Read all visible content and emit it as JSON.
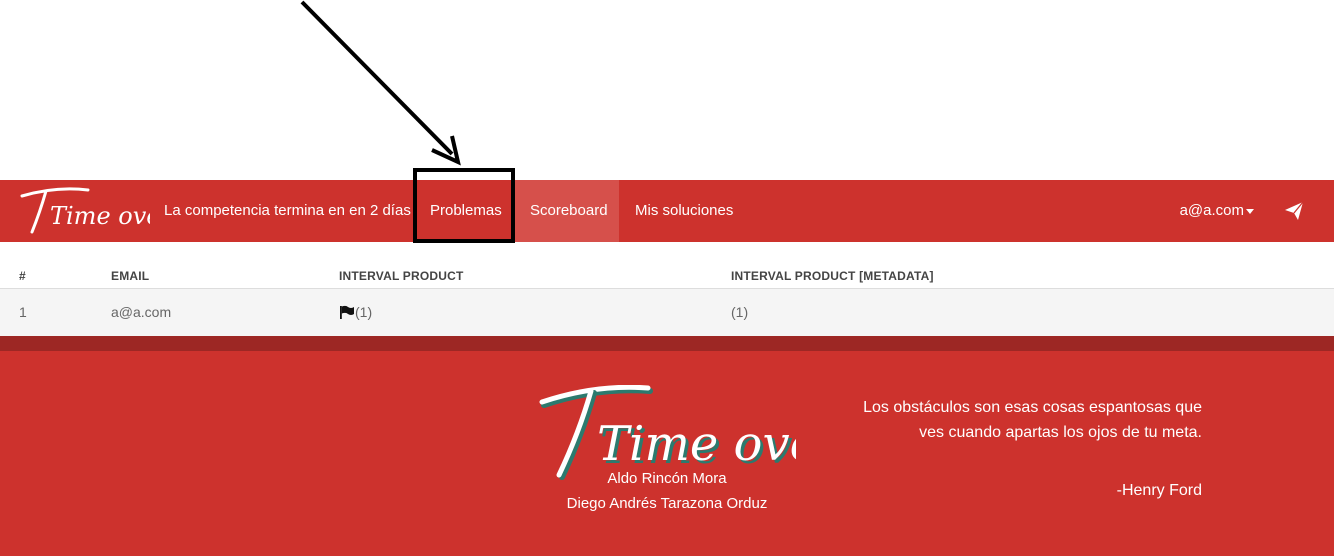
{
  "navbar": {
    "brand": "Time over",
    "countdown": "La competencia termina en en 2 días",
    "items": [
      {
        "label": "Problemas"
      },
      {
        "label": "Scoreboard"
      },
      {
        "label": "Mis soluciones"
      }
    ],
    "user": "a@a.com",
    "send_icon": "paper-plane-icon"
  },
  "table": {
    "headers": [
      "#",
      "EMAIL",
      "INTERVAL PRODUCT",
      "INTERVAL PRODUCT [METADATA]"
    ],
    "rows": [
      {
        "rank": "1",
        "email": "a@a.com",
        "p1": "(1)",
        "p2": "(1)"
      }
    ]
  },
  "footer": {
    "logo": "Time over",
    "authors": [
      "Aldo Rincón Mora",
      "Diego Andrés Tarazona Orduz"
    ],
    "quote": "Los obstáculos son esas cosas espantosas que ves cuando apartas los ojos de tu meta.",
    "quote_author": "-Henry Ford"
  },
  "colors": {
    "primary": "#cd322d",
    "active": "#d6504b",
    "dark": "#9d2724"
  }
}
